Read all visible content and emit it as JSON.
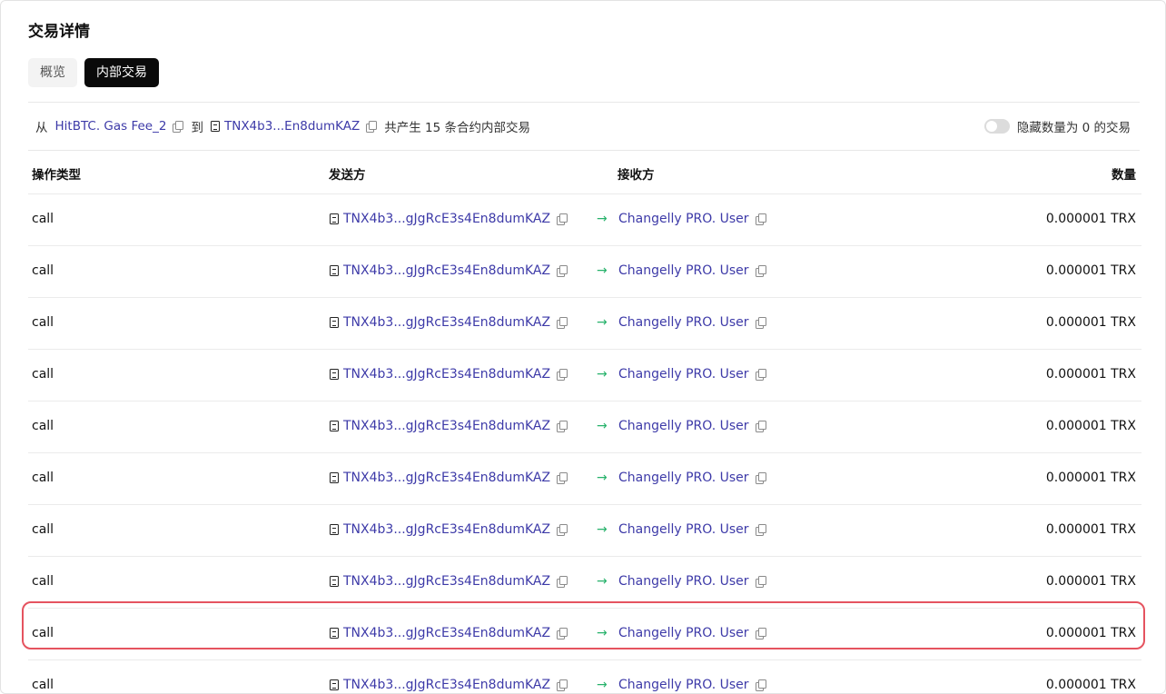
{
  "page_title": "交易详情",
  "tabs": [
    {
      "label": "概览",
      "active": false
    },
    {
      "label": "内部交易",
      "active": true
    }
  ],
  "summary": {
    "from_label": "从",
    "from_address": "HitBTC. Gas Fee_2",
    "to_label": "到",
    "to_address": "TNX4b3...En8dumKAZ",
    "count_text": "共产生 15 条合约内部交易"
  },
  "toggle": {
    "label": "隐藏数量为 0 的交易",
    "on": false
  },
  "table": {
    "headers": {
      "type": "操作类型",
      "from": "发送方",
      "to": "接收方",
      "amount": "数量"
    },
    "rows": [
      {
        "type": "call",
        "from": "TNX4b3...gJgRcE3s4En8dumKAZ",
        "to": "Changelly PRO. User",
        "amount": "0.000001 TRX"
      },
      {
        "type": "call",
        "from": "TNX4b3...gJgRcE3s4En8dumKAZ",
        "to": "Changelly PRO. User",
        "amount": "0.000001 TRX"
      },
      {
        "type": "call",
        "from": "TNX4b3...gJgRcE3s4En8dumKAZ",
        "to": "Changelly PRO. User",
        "amount": "0.000001 TRX"
      },
      {
        "type": "call",
        "from": "TNX4b3...gJgRcE3s4En8dumKAZ",
        "to": "Changelly PRO. User",
        "amount": "0.000001 TRX"
      },
      {
        "type": "call",
        "from": "TNX4b3...gJgRcE3s4En8dumKAZ",
        "to": "Changelly PRO. User",
        "amount": "0.000001 TRX"
      },
      {
        "type": "call",
        "from": "TNX4b3...gJgRcE3s4En8dumKAZ",
        "to": "Changelly PRO. User",
        "amount": "0.000001 TRX"
      },
      {
        "type": "call",
        "from": "TNX4b3...gJgRcE3s4En8dumKAZ",
        "to": "Changelly PRO. User",
        "amount": "0.000001 TRX"
      },
      {
        "type": "call",
        "from": "TNX4b3...gJgRcE3s4En8dumKAZ",
        "to": "Changelly PRO. User",
        "amount": "0.000001 TRX"
      },
      {
        "type": "call",
        "from": "TNX4b3...gJgRcE3s4En8dumKAZ",
        "to": "Changelly PRO. User",
        "amount": "0.000001 TRX"
      },
      {
        "type": "call",
        "from": "TNX4b3...gJgRcE3s4En8dumKAZ",
        "to": "Changelly PRO. User",
        "amount": "0.000001 TRX"
      }
    ]
  },
  "highlighted_row_index": 8,
  "colors": {
    "link": "#3d3aa8",
    "arrow": "#27b26b",
    "highlight": "#e5535f"
  }
}
